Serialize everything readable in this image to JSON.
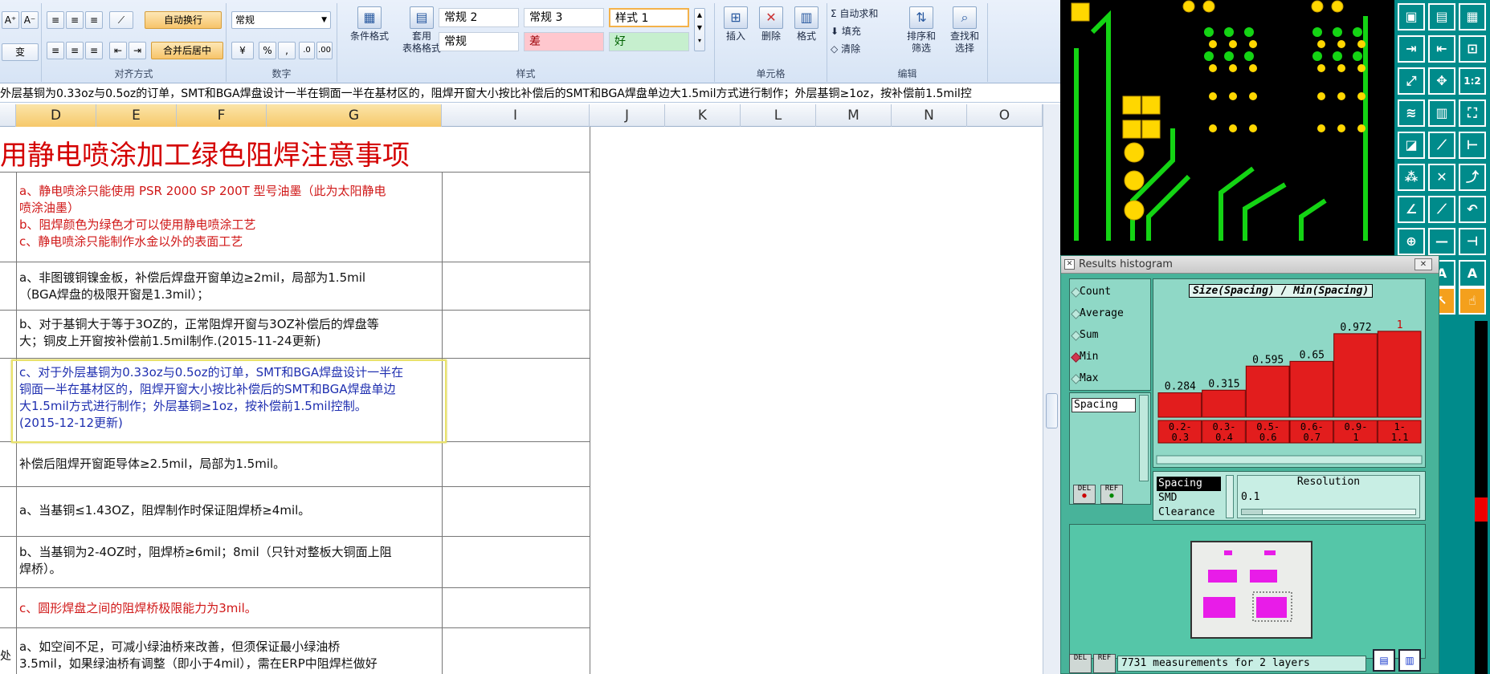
{
  "excel": {
    "ribbon": {
      "font_size_up": "A⁺",
      "font_size_down": "A⁻",
      "phonetic": "变",
      "wrap_text": "自动换行",
      "merge_center": "合并后居中",
      "number_format": "常规",
      "percent": "%",
      "comma": ",",
      "group_alignment": "对齐方式",
      "group_number": "数字",
      "group_styles": "样式",
      "group_cells": "单元格",
      "group_editing": "编辑",
      "conditional_format": "条件格式",
      "table_format_1": "套用",
      "table_format_2": "表格格式",
      "styles": [
        "常规 2",
        "常规 3",
        "样式 1",
        "常规",
        "差",
        "好"
      ],
      "insert": "插入",
      "delete": "删除",
      "format": "格式",
      "autosum": "自动求和",
      "fill": "填充",
      "clear": "清除",
      "sort_filter_1": "排序和",
      "sort_filter_2": "筛选",
      "find_select_1": "查找和",
      "find_select_2": "选择"
    },
    "formula_bar": "外层基铜为0.33oz与0.5oz的订单，SMT和BGA焊盘设计一半在铜面一半在基材区的，阻焊开窗大小按比补偿后的SMT和BGA焊盘单边大1.5mil方式进行制作；外层基铜≥1oz，按补偿前1.5mil控",
    "columns": [
      "D",
      "E",
      "F",
      "G",
      "I",
      "J",
      "K",
      "L",
      "M",
      "N",
      "O"
    ],
    "sheet": {
      "title": "用静电喷涂加工绿色阻焊注意事项",
      "rows": [
        {
          "lines": [
            "a、静电喷涂只能使用 PSR 2000 SP 200T 型号油墨（此为太阳静电",
            "喷涂油墨）"
          ],
          "color": "red"
        },
        {
          "lines": [
            "b、阻焊颜色为绿色才可以使用静电喷涂工艺"
          ],
          "color": "red"
        },
        {
          "lines": [
            "c、静电喷涂只能制作水金以外的表面工艺"
          ],
          "color": "red"
        },
        {
          "lines": [
            "a、非图镀铜镍金板，补偿后焊盘开窗单边≥2mil，局部为1.5mil",
            "（BGA焊盘的极限开窗是1.3mil）；"
          ],
          "color": "blk"
        },
        {
          "lines": [
            "b、对于基铜大于等于3OZ的，正常阻焊开窗与3OZ补偿后的焊盘等",
            "大；铜皮上开窗按补偿前1.5mil制作.(2015-11-24更新)"
          ],
          "color": "blk"
        },
        {
          "lines": [
            "c、对于外层基铜为0.33oz与0.5oz的订单，SMT和BGA焊盘设计一半在",
            "铜面一半在基材区的，阻焊开窗大小按比补偿后的SMT和BGA焊盘单边",
            "大1.5mil方式进行制作；外层基铜≥1oz，按补偿前1.5mil控制。",
            "(2015-12-12更新)"
          ],
          "color": "blue"
        },
        {
          "lines": [
            "补偿后阻焊开窗距导体≥2.5mil，局部为1.5mil。"
          ],
          "color": "blk"
        },
        {
          "lines": [
            "a、当基铜≤1.43OZ，阻焊制作时保证阻焊桥≥4mil。"
          ],
          "color": "blk"
        },
        {
          "lines": [
            "b、当基铜为2-4OZ时，阻焊桥≥6mil；8mil（只针对整板大铜面上阻",
            "焊桥）。"
          ],
          "color": "blk"
        },
        {
          "lines": [
            "c、圆形焊盘之间的阻焊桥极限能力为3mil。"
          ],
          "color": "red"
        },
        {
          "lines": [
            "a、如空间不足，可减小绿油桥来改善，但须保证最小绿油桥",
            "3.5mil，如果绿油桥有调整（即小于4mil），需在ERP中阻焊栏做好"
          ],
          "color": "blk"
        }
      ],
      "left_edge_char": "处"
    }
  },
  "cad": {
    "histogram": {
      "window_title": "Results histogram",
      "options": [
        "Count",
        "Average",
        "Sum",
        "Min",
        "Max"
      ],
      "selected_option": "Min",
      "chart_title": "Size(Spacing) / Min(Spacing)",
      "list_item": "Spacing",
      "resolution_label": "Resolution",
      "resolution_value": "0.1",
      "layers": [
        "Spacing",
        "SMD",
        "Clearance"
      ],
      "status": "7731 measurements for 2 layers",
      "del_label": "DEL",
      "ref_label": "REF",
      "close_label": "✕"
    },
    "toolbar_labels": [
      "1:2",
      "1:2"
    ]
  },
  "chart_data": {
    "type": "bar",
    "title": "Size(Spacing) / Min(Spacing)",
    "categories": [
      "0.2-0.3",
      "0.3-0.4",
      "0.5-0.6",
      "0.6-0.7",
      "0.9-1",
      "1-1.1"
    ],
    "values": [
      0.284,
      0.315,
      0.595,
      0.65,
      0.972,
      1
    ],
    "value_labels": [
      "0.284",
      "0.315",
      "0.595",
      "0.65",
      "0.972",
      "1"
    ],
    "ylim": [
      0,
      1.4
    ],
    "grid": false
  }
}
